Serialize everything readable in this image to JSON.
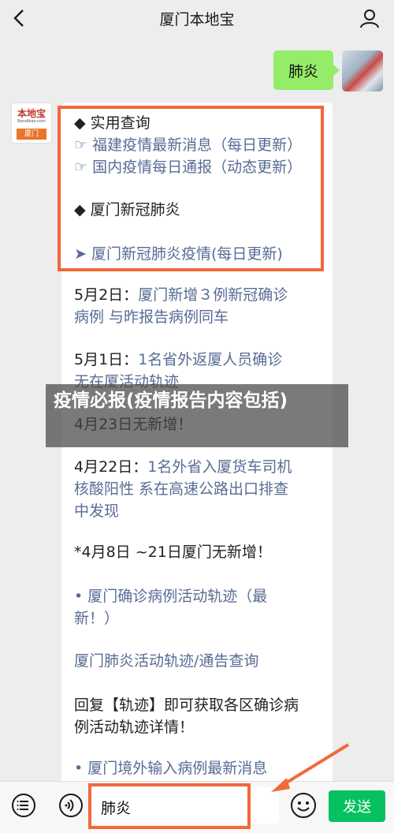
{
  "header": {
    "title": "厦门本地宝"
  },
  "sent_message": {
    "text": "肺炎"
  },
  "bot_avatar": {
    "logo_text": "本地宝",
    "logo_url": "Bendibao.com",
    "logo_city": "厦门"
  },
  "card": {
    "lines": [
      {
        "text": "◆  实用查询",
        "style": "dark"
      },
      {
        "text": "☞ 福建疫情最新消息（每日更新）",
        "style": "link"
      },
      {
        "text": "☞ 国内疫情每日通报（动态更新）",
        "style": "link"
      },
      {
        "text": "◆  厦门新冠肺炎",
        "style": "dark"
      },
      {
        "text": "➤ 厦门新冠肺炎疫情(每日更新)",
        "style": "link"
      },
      {
        "text": "5月2日：",
        "style": "dark",
        "suffix": "厦门新增３例新冠确诊"
      },
      {
        "text": "病例 与昨报告病例同车",
        "style": "link"
      },
      {
        "text": "5月1日：",
        "style": "dark",
        "suffix": "1名省外返厦人员确诊"
      },
      {
        "text": "无在厦活动轨迹",
        "style": "link"
      },
      {
        "text": "4月23日无新增！",
        "style": "dark"
      },
      {
        "text": "4月22日：",
        "style": "dark",
        "suffix": "1名外省入厦货车司机"
      },
      {
        "text": "核酸阳性 系在高速公路出口排查",
        "style": "link"
      },
      {
        "text": "中发现",
        "style": "link"
      },
      {
        "text": "*4月8日 ~21日厦门无新增！",
        "style": "dark"
      },
      {
        "text": "• 厦门确诊病例活动轨迹（最",
        "style": "link"
      },
      {
        "text": "新！）",
        "style": "link"
      },
      {
        "text": "厦门肺炎活动轨迹/通告查询",
        "style": "link"
      },
      {
        "text": "回复【轨迹】即可获取各区确诊病",
        "style": "dark"
      },
      {
        "text": "例活动轨迹详情！",
        "style": "dark"
      },
      {
        "text": "• 厦门境外输入病例最新消息",
        "style": "link"
      }
    ]
  },
  "overlay": {
    "text": "疫情必报(疫情报告内容包括)"
  },
  "input": {
    "value": "肺炎"
  },
  "send_button": {
    "label": "发送"
  },
  "colors": {
    "accent_green": "#07c160",
    "bubble_green": "#95ec69",
    "highlight": "#f06a3a",
    "link": "#586c94"
  }
}
